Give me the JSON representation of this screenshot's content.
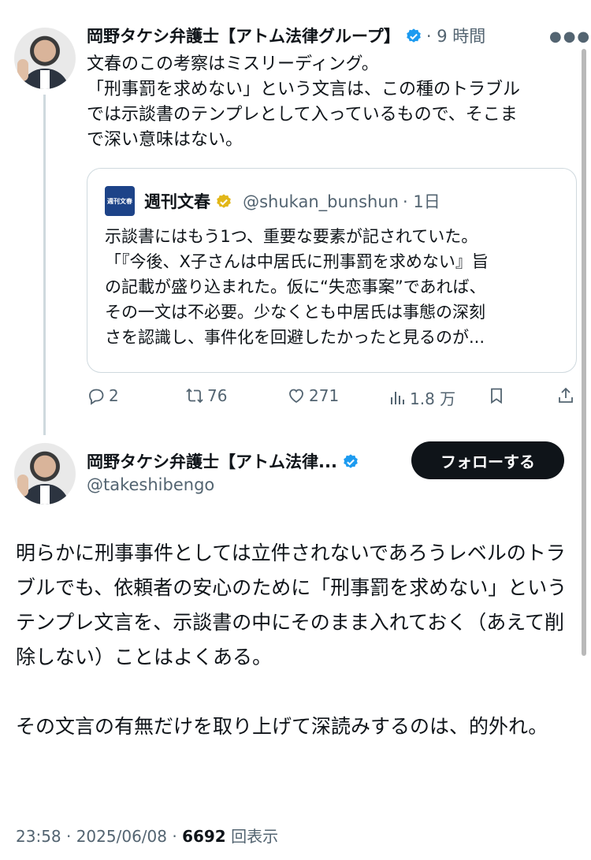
{
  "tweet1": {
    "author_name": "岡野タケシ弁護士【アトム法律グループ】",
    "time": "· 9 時間",
    "text_lines": [
      "文春のこの考察はミスリーディング。",
      "「刑事罰を求めない」という文言は、この種のトラブル",
      "では示談書のテンプレとして入っているもので、そこま",
      "で深い意味はない。"
    ]
  },
  "quote": {
    "logo_text": "週刊文春",
    "author_name": "週刊文春",
    "handle": "@shukan_bunshun",
    "time": "· 1日",
    "text_lines": [
      "示談書にはもう1つ、重要な要素が記されていた。",
      "「『今後、X子さんは中居氏に刑事罰を求めない』旨",
      "の記載が盛り込まれた。仮に“失恋事案”であれば、",
      "その一文は不必要。少なくとも中居氏は事態の深刻",
      "さを認識し、事件化を回避したかったと見るのが..."
    ]
  },
  "actions": {
    "replies": "2",
    "retweets": "76",
    "likes": "271",
    "views": "1.8 万"
  },
  "tweet2": {
    "author_name": "岡野タケシ弁護士【アトム法律...",
    "handle": "@takeshibengo",
    "follow_label": "フォローする",
    "paragraphs": [
      "明らかに刑事事件としては立件されないであろうレベルのトラブルでも、依頼者の安心のために「刑事罰を求めない」というテンプレ文言を、示談書の中にそのまま入れておく（あえて削除しない）ことはよくある。",
      "その文言の有無だけを取り上げて深読みするのは、的外れ。"
    ],
    "footer_time": "23:58 · 2025/06/08 · ",
    "footer_views_count": "6692",
    "footer_views_label": " 回表示"
  },
  "colors": {
    "verified_blue": "#1d9bf0",
    "verified_gold": "#e2b719",
    "text_primary": "#0f1419",
    "text_secondary": "#536471",
    "border": "#cfd9de"
  },
  "icons": [
    "more-icon",
    "verified-icon",
    "reply-icon",
    "retweet-icon",
    "like-icon",
    "views-icon",
    "bookmark-icon",
    "share-icon"
  ]
}
